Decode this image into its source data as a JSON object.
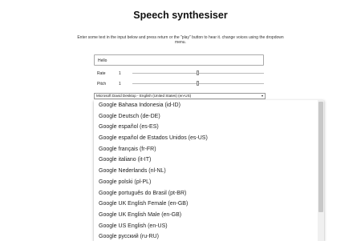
{
  "page": {
    "title": "Speech synthesiser",
    "instructions": "Enter some text in the input below and press return or the \"play\" button to hear it. change voices using the dropdown menu."
  },
  "text_input": {
    "value": "Hello"
  },
  "rate": {
    "label": "Rate",
    "value": "1",
    "level": 0.5
  },
  "pitch": {
    "label": "Pitch",
    "value": "1",
    "level": 0.5
  },
  "voice_select": {
    "selected": "Microsoft David Desktop - English (United States) (en-US)",
    "arrow": "▾",
    "options": [
      "Google Bahasa Indonesia (id-ID)",
      "Google Deutsch (de-DE)",
      "Google español (es-ES)",
      "Google español de Estados Unidos (es-US)",
      "Google français (fr-FR)",
      "Google italiano (it-IT)",
      "Google Nederlands (nl-NL)",
      "Google polski (pl-PL)",
      "Google português do Brasil (pt-BR)",
      "Google UK English Female (en-GB)",
      "Google UK English Male (en-GB)",
      "Google US English (en-US)",
      "Google русский (ru-RU)"
    ]
  },
  "colors": {
    "background": "#ffffff",
    "text": "#222222",
    "border": "#aaaaaa"
  }
}
